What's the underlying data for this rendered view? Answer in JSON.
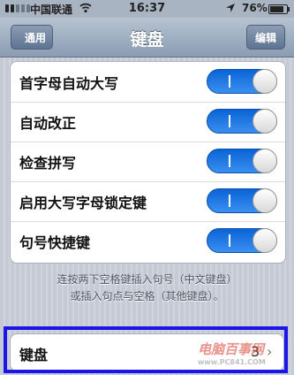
{
  "status_bar": {
    "carrier": "中国联通",
    "time": "16:37",
    "battery_percent": "76%",
    "icons": [
      "signal-icon",
      "wifi-icon",
      "location-icon",
      "battery-icon"
    ]
  },
  "nav": {
    "back_label": "通用",
    "title": "键盘",
    "edit_label": "编辑"
  },
  "settings": [
    {
      "label": "首字母自动大写",
      "on": true
    },
    {
      "label": "自动改正",
      "on": true
    },
    {
      "label": "检查拼写",
      "on": true
    },
    {
      "label": "启用大写字母锁定键",
      "on": true
    },
    {
      "label": "句号快捷键",
      "on": true
    }
  ],
  "footnote": {
    "line1": "连按两下空格键插入句号（中文键盘）",
    "line2": "或插入句点与空格（其他键盘）。"
  },
  "keyboard_row": {
    "label": "键盘",
    "value": "3"
  },
  "watermark": {
    "text": "电脑百事网",
    "sub": "www.PC841.COM"
  },
  "colors": {
    "switch_on": "#1a73e8",
    "highlight_border": "#1b15e8",
    "nav_bar": "#8b9db3"
  }
}
